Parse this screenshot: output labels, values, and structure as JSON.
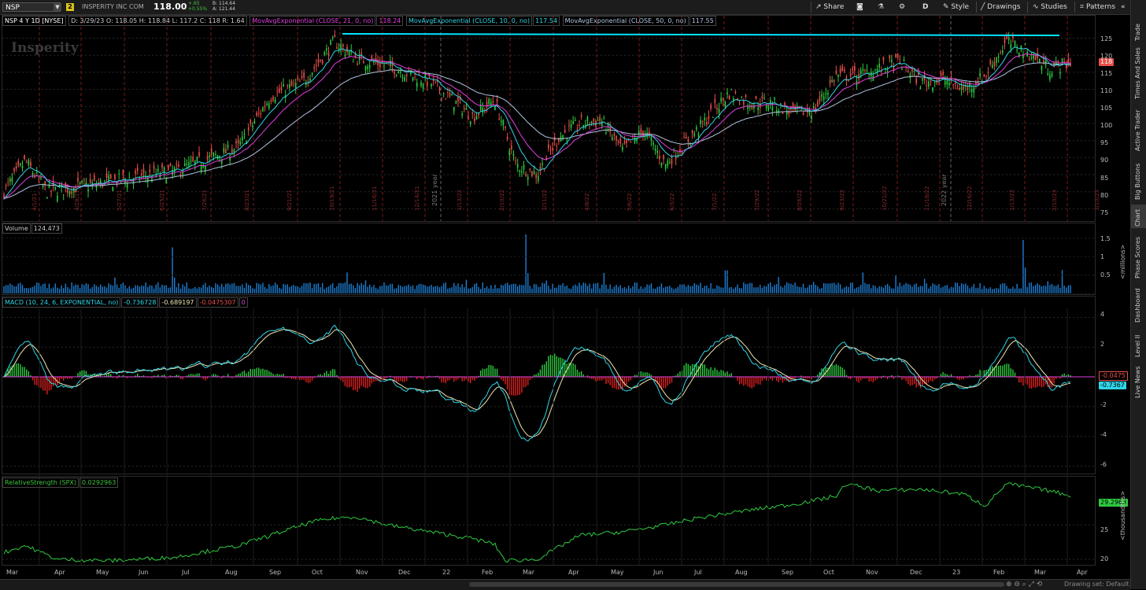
{
  "toolbar": {
    "symbol": "NSP",
    "link_number": "2",
    "company": "INSPERITY INC COM",
    "last": "118.00",
    "change": "+.65",
    "change_pct": "+0.55%",
    "bid": "B: 114.64",
    "ask": "A: 121.44",
    "buttons": {
      "share": "Share",
      "aggregation": "D",
      "style": "Style",
      "drawings": "Drawings",
      "studies": "Studies",
      "patterns": "Patterns"
    }
  },
  "sidebar": {
    "tabs": [
      "Trade",
      "Times And Sales",
      "Active Trader",
      "Big Buttons",
      "Chart",
      "Phase Scores",
      "Dashboard",
      "Level II",
      "Live News"
    ],
    "active": "Chart"
  },
  "price_pane": {
    "title": "NSP 4 Y 1D [NYSE]",
    "ohlc": "D: 3/29/23   O: 118.05   H: 118.84   L: 117.2   C: 118   R: 1.64",
    "studies": [
      {
        "label": "MovAvgExponential (CLOSE, 21, 0, no)",
        "value": "118.24",
        "color": "#e040e0"
      },
      {
        "label": "MovAvgExponential (CLOSE, 10, 0, no)",
        "value": "117.54",
        "color": "#30d5e8"
      },
      {
        "label": "MovAvgExponential (CLOSE, 50, 0, no)",
        "value": "117.55",
        "color": "#b0c4de"
      }
    ],
    "watermark": "Insperity",
    "last_badge": "118",
    "ticks": [
      "125",
      "120",
      "115",
      "110",
      "105",
      "100",
      "95",
      "90",
      "85",
      "80",
      "75"
    ],
    "year_labels": [
      "2021 year",
      "2022 year"
    ],
    "date_labels": [
      "4/1/21",
      "4/28/21",
      "5/27/21",
      "6/25/21",
      "7/26/21",
      "8/23/21",
      "9/21/21",
      "10/19/21",
      "11/16/21",
      "12/14/21",
      "1/13/22",
      "2/10/22",
      "3/11/22",
      "4/8/22",
      "5/6/22",
      "6/3/22",
      "7/1/22",
      "7/29/22",
      "8/26/22",
      "9/23/22",
      "10/21/22",
      "11/18/22",
      "12/16/22",
      "1/13/23",
      "2/10/23",
      "3/10/23"
    ],
    "colors": {
      "up": "#2ecc40",
      "down": "#e8504a",
      "trendline": "#00e5ff"
    }
  },
  "volume_pane": {
    "label": "Volume",
    "value": "124,473",
    "ticks": [
      "1.5",
      "1",
      "0.5"
    ],
    "unit": "<millions>",
    "color": "#1e7fd4"
  },
  "macd_pane": {
    "label": "MACD (10, 24, 6, EXPONENTIAL, no)",
    "values": [
      "-0.736728",
      "-0.689197",
      "-0.0475307",
      "0"
    ],
    "ticks": [
      "4",
      "2",
      "-2",
      "-4",
      "-6"
    ],
    "badge_diff": "-0.0475",
    "badge_macd": "-0.7367"
  },
  "rs_pane": {
    "label": "RelativeStrength (SPX)",
    "value": "0.0292963",
    "ticks": [
      "25",
      "20"
    ],
    "badge": "29.2963",
    "unit": "<thousandths>"
  },
  "x_axis": [
    "Mar",
    "Apr",
    "May",
    "Jun",
    "Jul",
    "Aug",
    "Sep",
    "Oct",
    "Nov",
    "Dec",
    "22",
    "Feb",
    "Mar",
    "Apr",
    "May",
    "Jun",
    "Jul",
    "Aug",
    "Sep",
    "Oct",
    "Nov",
    "Dec",
    "23",
    "Feb",
    "Mar",
    "Apr"
  ],
  "status": "Drawing set: Default"
}
